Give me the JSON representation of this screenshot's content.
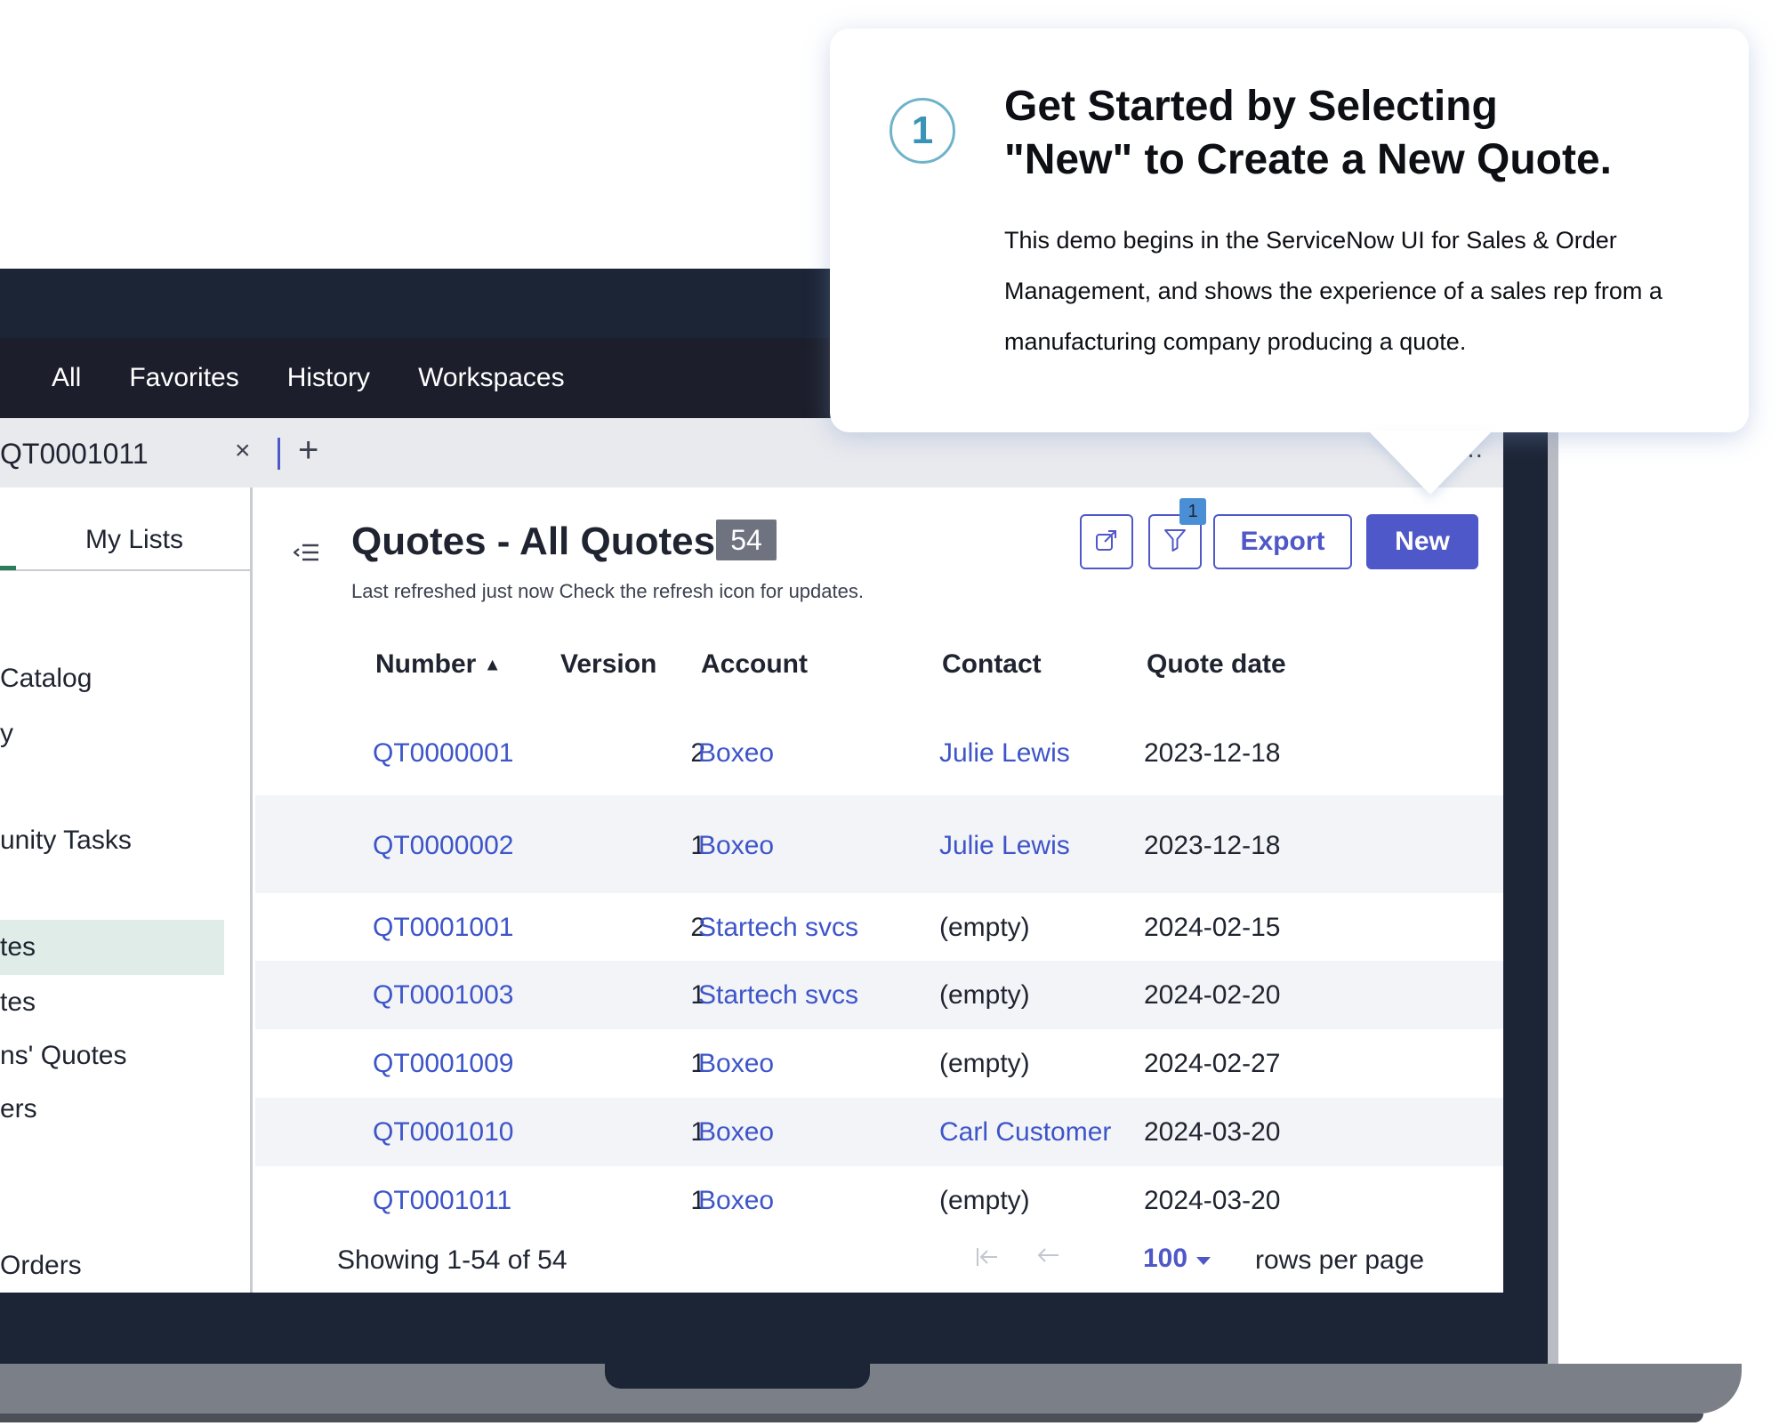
{
  "callout": {
    "step": "1",
    "title_line1": "Get Started by Selecting",
    "title_line2": "\"New\" to Create a New Quote.",
    "body": "This demo begins in the ServiceNow UI for Sales & Order Management, and shows the experience of a sales rep from a manufacturing company producing a quote."
  },
  "nav": {
    "items": [
      "All",
      "Favorites",
      "History",
      "Workspaces"
    ]
  },
  "tab": {
    "label": "QT0001011",
    "close": "×",
    "add": "+",
    "more": "..."
  },
  "sidebar": {
    "tab_label": "My Lists",
    "items": [
      {
        "label": "Catalog",
        "active": false
      },
      {
        "label": "y",
        "active": false
      },
      {
        "label": "unity Tasks",
        "active": false
      },
      {
        "label": "tes",
        "active": true
      },
      {
        "label": "tes",
        "active": false
      },
      {
        "label": "ns' Quotes",
        "active": false
      },
      {
        "label": "ers",
        "active": false
      },
      {
        "label": "Orders",
        "active": false
      }
    ]
  },
  "header": {
    "toggle_icon": "list-collapse-icon",
    "title": "Quotes - All Quotes",
    "count": "54",
    "subtitle": "Last refreshed just now Check the refresh icon for updates.",
    "share_icon": "share-icon",
    "filter_icon": "filter-icon",
    "filter_count": "1",
    "export_label": "Export",
    "new_label": "New"
  },
  "table": {
    "columns": [
      "Number",
      "Version",
      "Account",
      "Contact",
      "Quote date"
    ],
    "sort_indicator": "▲",
    "rows": [
      {
        "number": "QT0000001",
        "version": "2",
        "account": "Boxeo",
        "contact": "Julie Lewis",
        "contact_is_link": true,
        "date": "2023-12-18"
      },
      {
        "number": "QT0000002",
        "version": "1",
        "account": "Boxeo",
        "contact": "Julie Lewis",
        "contact_is_link": true,
        "date": "2023-12-18"
      },
      {
        "number": "QT0001001",
        "version": "2",
        "account": "Startech svcs",
        "contact": "(empty)",
        "contact_is_link": false,
        "date": "2024-02-15"
      },
      {
        "number": "QT0001003",
        "version": "1",
        "account": "Startech svcs",
        "contact": "(empty)",
        "contact_is_link": false,
        "date": "2024-02-20"
      },
      {
        "number": "QT0001009",
        "version": "1",
        "account": "Boxeo",
        "contact": "(empty)",
        "contact_is_link": false,
        "date": "2024-02-27"
      },
      {
        "number": "QT0001010",
        "version": "1",
        "account": "Boxeo",
        "contact": "Carl Customer",
        "contact_is_link": true,
        "date": "2024-03-20"
      },
      {
        "number": "QT0001011",
        "version": "1",
        "account": "Boxeo",
        "contact": "(empty)",
        "contact_is_link": false,
        "date": "2024-03-20"
      }
    ]
  },
  "footer": {
    "showing": "Showing 1-54 of 54",
    "rows_per_page_value": "100",
    "rows_per_page_label": "rows per page"
  },
  "colors": {
    "accent": "#4f58c8",
    "link": "#3d55c9",
    "nav_bg": "#1c1f2b",
    "frame": "#1c2536",
    "active_item": "#dfece8"
  }
}
